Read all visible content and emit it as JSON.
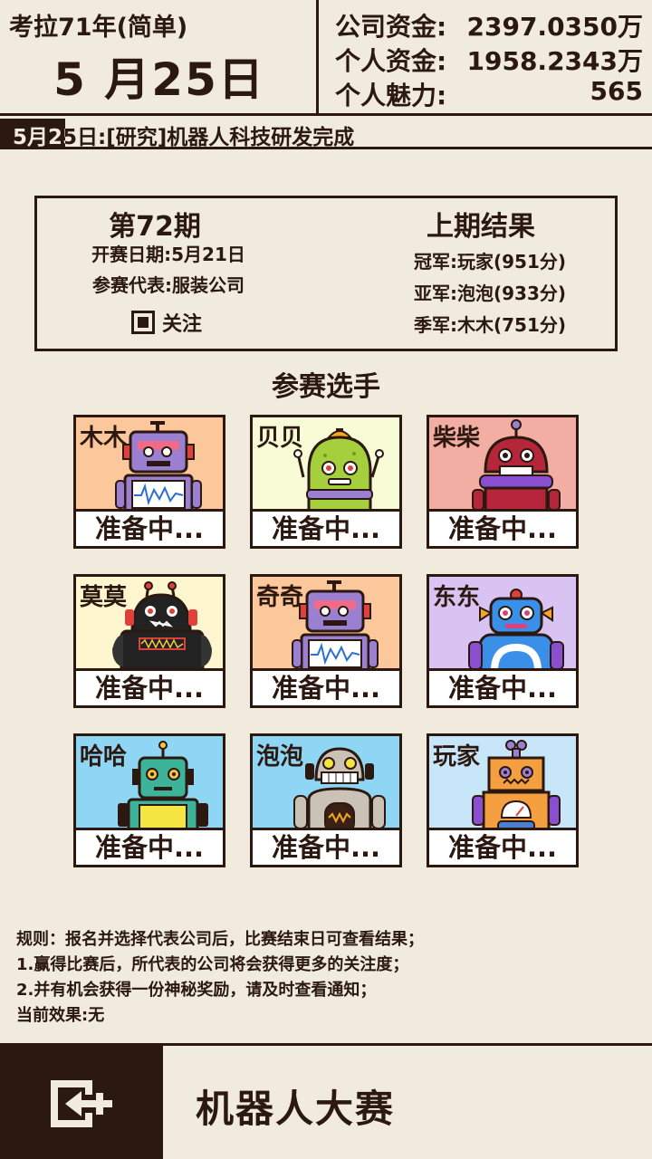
{
  "header": {
    "era": "考拉71年(简单)",
    "date": "5 月25日",
    "stats": [
      {
        "label": "公司资金:",
        "value": "2397.0350万"
      },
      {
        "label": "个人资金:",
        "value": "1958.2343万"
      },
      {
        "label": "个人魅力:",
        "value": "565"
      }
    ]
  },
  "ticker": {
    "text": "5月25日:[研究]机器人科技研发完成"
  },
  "info": {
    "period": "第72期",
    "open_date": "开赛日期:5月21日",
    "representative": "参赛代表:服装公司",
    "follow_label": "关注",
    "last_title": "上期结果",
    "results": [
      "冠军:玩家(951分)",
      "亚军:泡泡(933分)",
      "季军:木木(751分)"
    ]
  },
  "players_title": "参赛选手",
  "players": [
    {
      "name": "木木",
      "status": "准备中...",
      "bg": "#fcc79a",
      "robot": "r1"
    },
    {
      "name": "贝贝",
      "status": "准备中...",
      "bg": "#f7fbd6",
      "robot": "r2"
    },
    {
      "name": "柴柴",
      "status": "准备中...",
      "bg": "#f2aea3",
      "robot": "r3"
    },
    {
      "name": "莫莫",
      "status": "准备中...",
      "bg": "#fef6cf",
      "robot": "r4"
    },
    {
      "name": "奇奇",
      "status": "准备中...",
      "bg": "#fcc79a",
      "robot": "r1"
    },
    {
      "name": "东东",
      "status": "准备中...",
      "bg": "#d8c3f2",
      "robot": "r5"
    },
    {
      "name": "哈哈",
      "status": "准备中...",
      "bg": "#8fd6f4",
      "robot": "r6"
    },
    {
      "name": "泡泡",
      "status": "准备中...",
      "bg": "#8fd6f4",
      "robot": "r7"
    },
    {
      "name": "玩家",
      "status": "准备中...",
      "bg": "#c8e6f9",
      "robot": "r8"
    }
  ],
  "rules": [
    "规则：报名并选择代表公司后，比赛结束日可查看结果；",
    "1.赢得比赛后，所代表的公司将会获得更多的关注度；",
    "2.并有机会获得一份神秘奖励，请及时查看通知；",
    "当前效果:无"
  ],
  "bottom": {
    "title": "机器人大赛",
    "exit_icon": "exit-door-icon"
  },
  "colors": {
    "background": "#f1ebde",
    "ink": "#2b1810"
  }
}
